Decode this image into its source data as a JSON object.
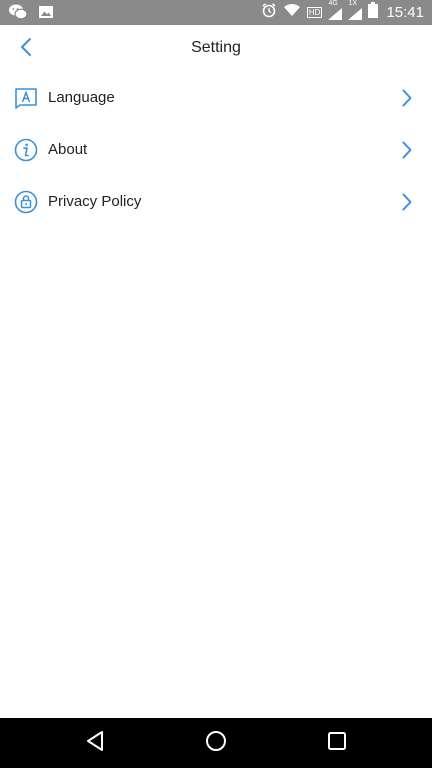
{
  "status_bar": {
    "time": "15:41",
    "network": "4G",
    "sim": "1X",
    "hd": "HD",
    "icons": [
      "wechat-icon",
      "image-icon",
      "alarm-icon",
      "wifi-icon",
      "hd-icon",
      "signal-icon",
      "battery-icon"
    ]
  },
  "header": {
    "title": "Setting",
    "back_icon": "chevron-left-icon"
  },
  "menu": {
    "items": [
      {
        "label": "Language",
        "icon": "language-icon"
      },
      {
        "label": "About",
        "icon": "info-icon"
      },
      {
        "label": "Privacy Policy",
        "icon": "lock-icon"
      }
    ],
    "chevron_icon": "chevron-right-icon"
  },
  "nav_bar": {
    "icons": [
      "nav-back-icon",
      "nav-home-icon",
      "nav-recents-icon"
    ]
  },
  "colors": {
    "accent": "#3d8fd6",
    "status_bar": "#8a8a8a",
    "nav_bar": "#000000",
    "text": "#222222"
  }
}
